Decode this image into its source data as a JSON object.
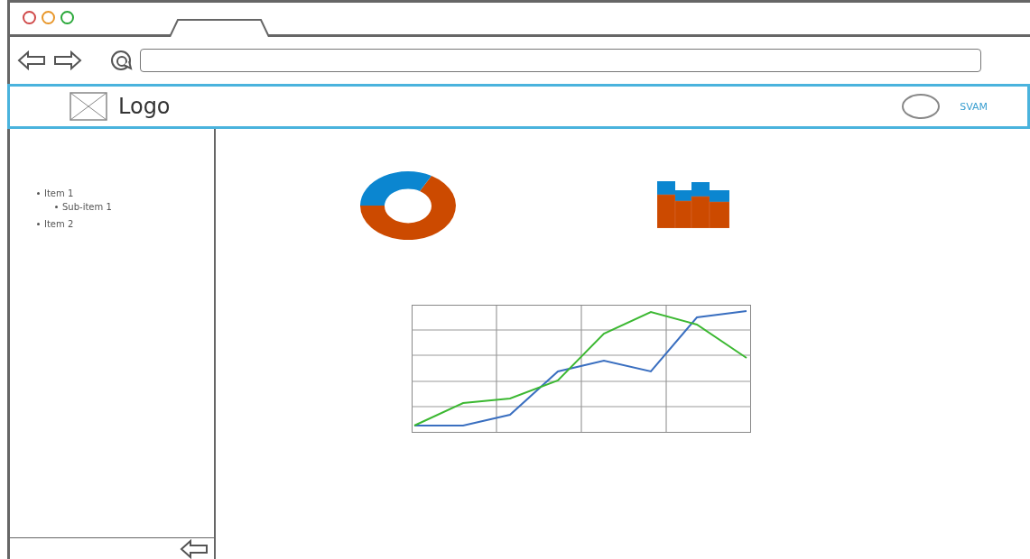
{
  "header": {
    "logo_text": "Logo",
    "user_name": "SVAM"
  },
  "sidebar": {
    "items": [
      {
        "label": "Item 1",
        "children": [
          {
            "label": "Sub-item 1"
          }
        ]
      },
      {
        "label": "Item 2"
      }
    ]
  }
}
